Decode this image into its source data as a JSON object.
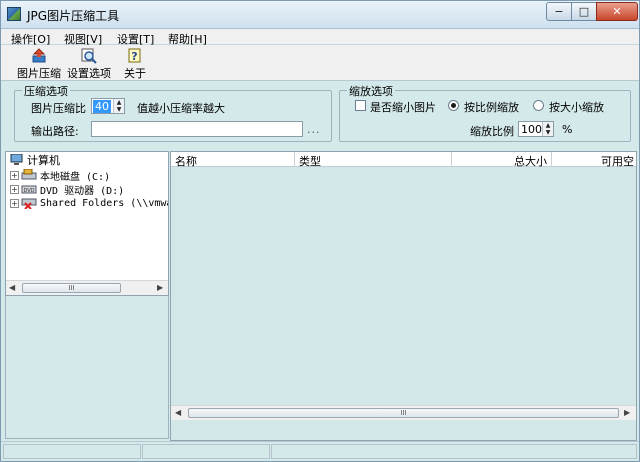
{
  "window": {
    "title": "JPG图片压缩工具",
    "controls": {
      "minimize": "−",
      "maximize": "□",
      "close": "✕"
    }
  },
  "menu": [
    "操作[O]",
    "视图[V]",
    "设置[T]",
    "帮助[H]"
  ],
  "toolbar": {
    "compress_label": "图片压缩",
    "settings_label": "设置选项",
    "about_label": "关于"
  },
  "compress_options": {
    "title": "压缩选项",
    "ratio_label": "图片压缩比",
    "ratio_value": "40",
    "ratio_hint": "值越小压缩率越大",
    "output_label": "输出路径:",
    "output_value": "",
    "browse_label": "..."
  },
  "scale_options": {
    "title": "缩放选项",
    "shrink_label": "是否缩小图片",
    "proportional_label": "按比例缩放",
    "by_size_label": "按大小缩放",
    "ratio_label": "缩放比例",
    "ratio_value": "100",
    "unit": "%"
  },
  "tree": {
    "root": "计算机",
    "items": [
      {
        "label": "本地磁盘 (C:)"
      },
      {
        "label": "DVD 驱动器 (D:)"
      },
      {
        "label": "Shared Folders (\\\\vmware"
      }
    ]
  },
  "list": {
    "columns": [
      "名称",
      "类型",
      "总大小",
      "可用空"
    ]
  },
  "scrollbar_grip": "III",
  "colors": {
    "panel_bg": "#d4e9e9",
    "selection": "#3399ff",
    "close_red": "#c8452b"
  }
}
